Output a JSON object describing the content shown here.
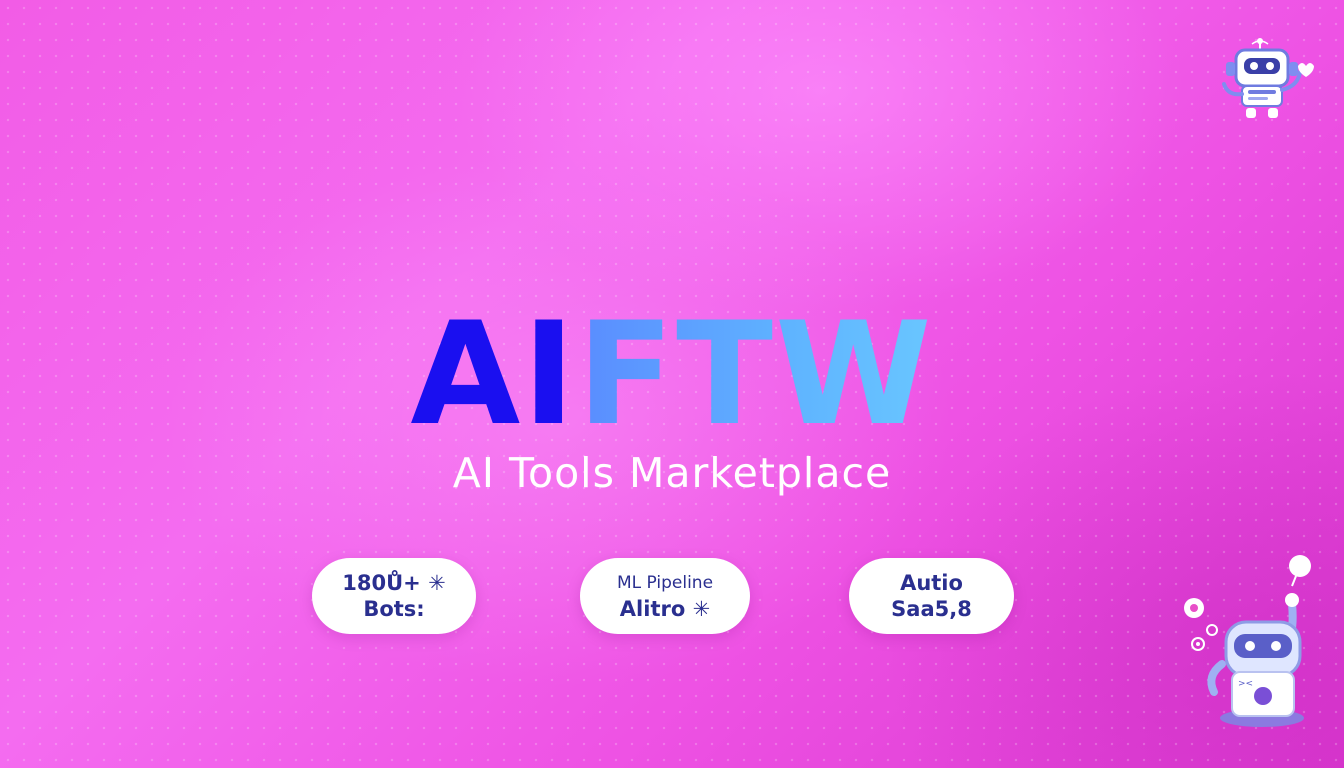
{
  "brand": {
    "logo_part1": "AI",
    "logo_part2": "FTW",
    "tagline": "AI Tools Marketplace"
  },
  "badges": [
    {
      "line1": "180Ů+ ✳",
      "line2": "Bots:"
    },
    {
      "line1": "ML Pipeline",
      "line2": "Alitro ✳"
    },
    {
      "line1": "Autio",
      "line2": "Saa5,8"
    }
  ],
  "icons": {
    "top_right": "robot-icon",
    "bottom_right": "robot-mascot-icon"
  },
  "colors": {
    "background": "#f25ce6",
    "logo_ai": "#1a0ff0",
    "logo_ftw": "#5fa6ff",
    "badge_text": "#2a2f8f"
  }
}
